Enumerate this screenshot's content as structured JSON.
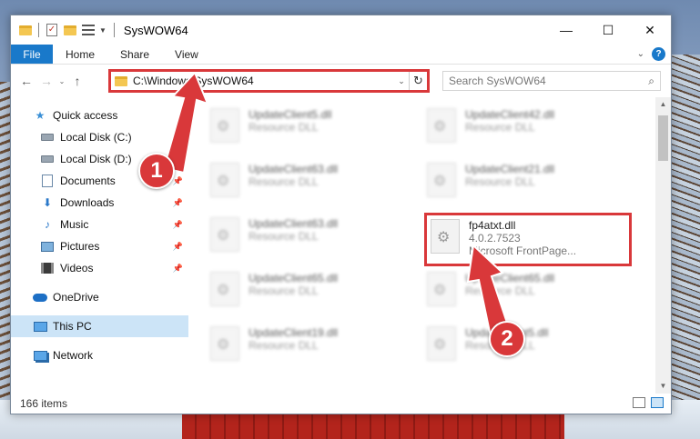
{
  "window": {
    "title": "SysWOW64",
    "controls": {
      "minimize": "—",
      "maximize": "☐",
      "close": "✕"
    }
  },
  "ribbon": {
    "tabs": [
      "File",
      "Home",
      "Share",
      "View"
    ]
  },
  "address": {
    "path": "C:\\Windows\\SysWOW64",
    "search_placeholder": "Search SysWOW64"
  },
  "navpane": {
    "quick_access": "Quick access",
    "items": [
      {
        "label": "Local Disk (C:)",
        "icon": "drive-icon"
      },
      {
        "label": "Local Disk (D:)",
        "icon": "drive-icon"
      },
      {
        "label": "Documents",
        "icon": "documents-icon"
      },
      {
        "label": "Downloads",
        "icon": "downloads-icon"
      },
      {
        "label": "Music",
        "icon": "music-icon"
      },
      {
        "label": "Pictures",
        "icon": "pictures-icon"
      },
      {
        "label": "Videos",
        "icon": "videos-icon"
      }
    ],
    "onedrive": "OneDrive",
    "thispc": "This PC",
    "network": "Network"
  },
  "files": [
    {
      "name": "UpdateClient5.dll",
      "type": "Resource DLL"
    },
    {
      "name": "UpdateClient42.dll",
      "type": "Resource DLL"
    },
    {
      "name": "UpdateClient63.dll",
      "type": "Resource DLL"
    },
    {
      "name": "UpdateClient21.dll",
      "type": "Resource DLL"
    },
    {
      "name": "UpdateClient63.dll",
      "type": "Resource DLL"
    },
    {
      "name": "UpdateClient65.dll",
      "type": "Resource DLL"
    },
    {
      "name": "UpdateClient65.dll",
      "type": "Resource DLL"
    },
    {
      "name": "UpdateClient19.dll",
      "type": "Resource DLL"
    },
    {
      "name": "UpdateClient5.dll",
      "type": "Resource DLL"
    }
  ],
  "highlighted_file": {
    "name": "fp4atxt.dll",
    "version": "4.0.2.7523",
    "description": "Microsoft FrontPage..."
  },
  "status": {
    "item_count": "166 items"
  },
  "annotations": {
    "step1": "1",
    "step2": "2"
  },
  "colors": {
    "accent": "#1979ca",
    "highlight": "#d9383a"
  }
}
